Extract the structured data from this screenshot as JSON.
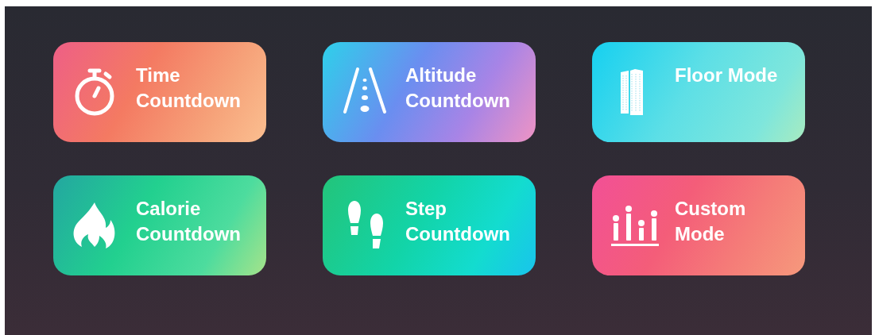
{
  "modes": [
    {
      "kind": "time",
      "label": "Time Countdown"
    },
    {
      "kind": "altitude",
      "label": "Altitude Countdown"
    },
    {
      "kind": "floor",
      "label": "Floor Mode"
    },
    {
      "kind": "calorie",
      "label": "Calorie Countdown"
    },
    {
      "kind": "step",
      "label": "Step Countdown"
    },
    {
      "kind": "custom",
      "label": "Custom Mode"
    }
  ]
}
